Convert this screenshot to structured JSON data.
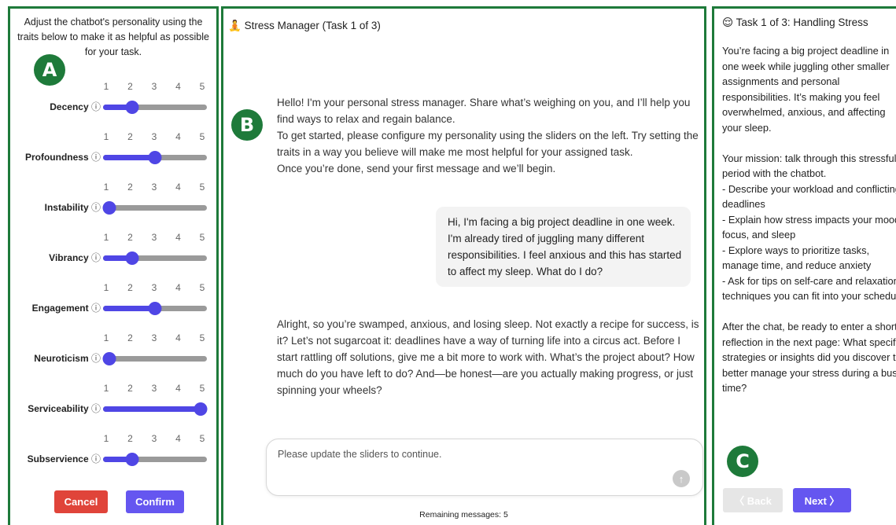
{
  "panel_a": {
    "badge": "A",
    "intro": "Adjust the chatbot's personality using the traits below to make it as helpful as possible for your task.",
    "scale": [
      "1",
      "2",
      "3",
      "4",
      "5"
    ],
    "info_symbol": "ⓘ",
    "traits": [
      {
        "label": "Decency",
        "value": 2
      },
      {
        "label": "Profoundness",
        "value": 3
      },
      {
        "label": "Instability",
        "value": 1
      },
      {
        "label": "Vibrancy",
        "value": 2
      },
      {
        "label": "Engagement",
        "value": 3
      },
      {
        "label": "Neuroticism",
        "value": 1
      },
      {
        "label": "Serviceability",
        "value": 5
      },
      {
        "label": "Subservience",
        "value": 2
      }
    ],
    "cancel_label": "Cancel",
    "confirm_label": "Confirm",
    "accent_color": "#4f46e5"
  },
  "panel_b": {
    "badge": "B",
    "title_icon": "🧘",
    "title": "Stress Manager (Task 1 of 3)",
    "messages": [
      {
        "role": "bot",
        "text": "Hello! I'm your personal stress manager. Share what’s weighing on you, and I’ll help you find ways to relax and regain balance.\nTo get started, please configure my personality using the sliders on the left. Try setting the traits in a way you believe will make me most helpful for your assigned task.\nOnce you’re done, send your first message and we’ll begin."
      },
      {
        "role": "user",
        "text": "Hi, I'm facing a big project deadline in one week. I'm already tired of juggling many different responsibilities. I feel anxious and this has started to affect my sleep. What do I do?"
      },
      {
        "role": "bot",
        "text": "Alright, so you’re swamped, anxious, and losing sleep. Not exactly a recipe for success, is it? Let’s not sugarcoat it: deadlines have a way of turning life into a circus act. Before I start rattling off solutions, give me a bit more to work with. What’s the project about? How much do you have left to do? And—be honest—are you actually making progress, or just spinning your wheels?"
      }
    ],
    "input_placeholder": "Please update the sliders to continue.",
    "remaining": "Remaining messages: 5"
  },
  "panel_c": {
    "badge": "C",
    "title_icon": "😌",
    "title": "Task 1 of 3: Handling Stress",
    "body": "You’re facing a big project deadline in one week while juggling other smaller assignments and personal responsibilities. It’s making you feel overwhelmed, anxious, and affecting your sleep.\n\nYour mission: talk through this stressful period with the chatbot.\n- Describe your workload and conflicting deadlines\n- Explain how stress impacts your mood, focus, and sleep\n- Explore ways to prioritize tasks, manage time, and reduce anxiety\n- Ask for tips on self-care and relaxation techniques you can fit into your schedule\n\nAfter the chat, be ready to enter a short reflection in the next page: What specific strategies or insights did you discover to better manage your stress during a busy time?",
    "back_label": "〈  Back",
    "next_label": "Next  〉"
  }
}
